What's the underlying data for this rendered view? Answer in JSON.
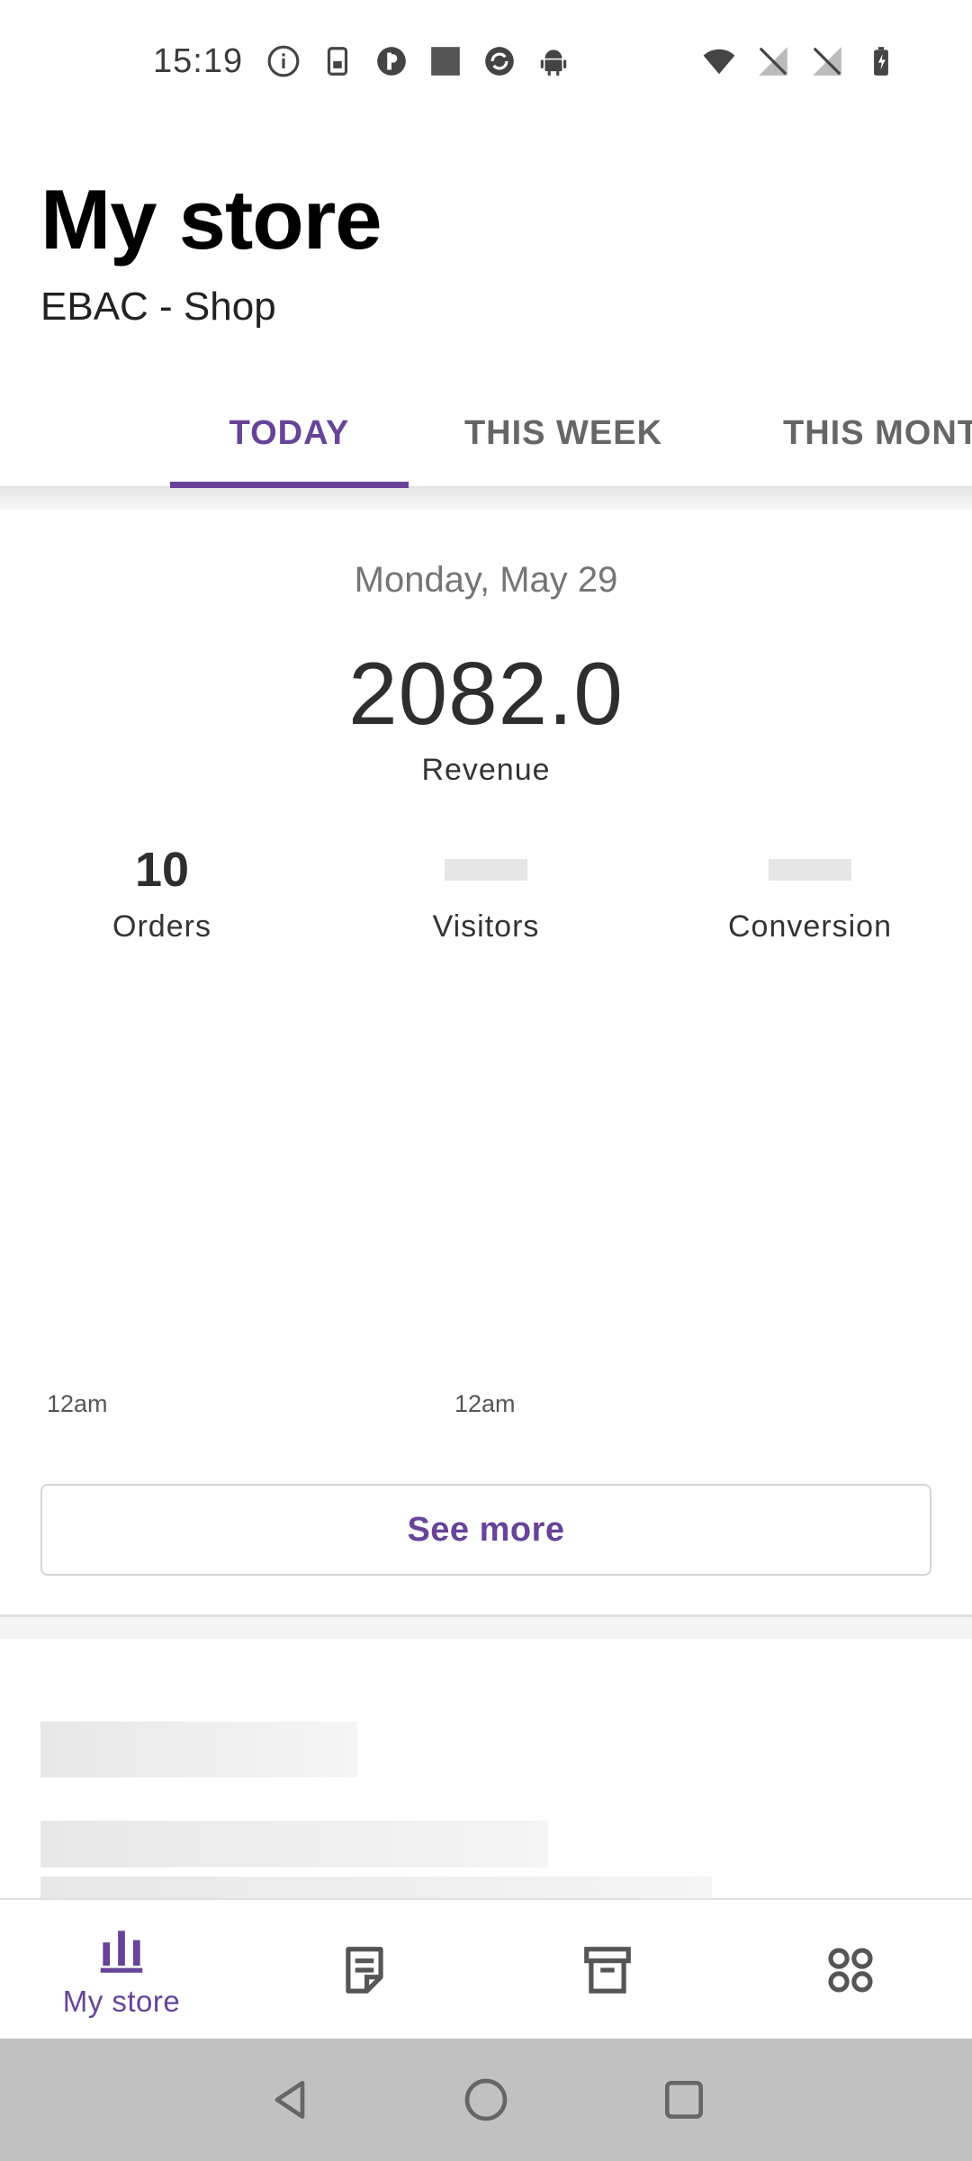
{
  "status_bar": {
    "time": "15:19",
    "left_icons": [
      "info-icon",
      "sim-icon",
      "cast-icon",
      "square-icon",
      "sync-icon",
      "android-icon"
    ],
    "right_icons": [
      "wifi-icon",
      "no-sim-1-icon",
      "no-sim-2-icon",
      "battery-charging-icon"
    ]
  },
  "header": {
    "title": "My store",
    "store_name": "EBAC - Shop"
  },
  "tabs": [
    {
      "label": "TODAY",
      "active": true
    },
    {
      "label": "THIS WEEK",
      "active": false
    },
    {
      "label": "THIS MONT",
      "active": false
    }
  ],
  "stats": {
    "date": "Monday, May 29",
    "revenue_value": "2082.0",
    "revenue_label": "Revenue",
    "orders_value": "10",
    "orders_label": "Orders",
    "visitors_label": "Visitors",
    "conversion_label": "Conversion",
    "axis_labels": [
      "12am",
      "12am"
    ],
    "see_more": "See more"
  },
  "bottom_nav": {
    "items": [
      {
        "label": "My store",
        "icon": "bar-chart-icon",
        "active": true
      },
      {
        "label": "",
        "icon": "orders-icon",
        "active": false
      },
      {
        "label": "",
        "icon": "products-icon",
        "active": false
      },
      {
        "label": "",
        "icon": "menu-grid-icon",
        "active": false
      }
    ]
  },
  "colors": {
    "accent": "#674399",
    "system_nav": "#c1c1c1"
  }
}
